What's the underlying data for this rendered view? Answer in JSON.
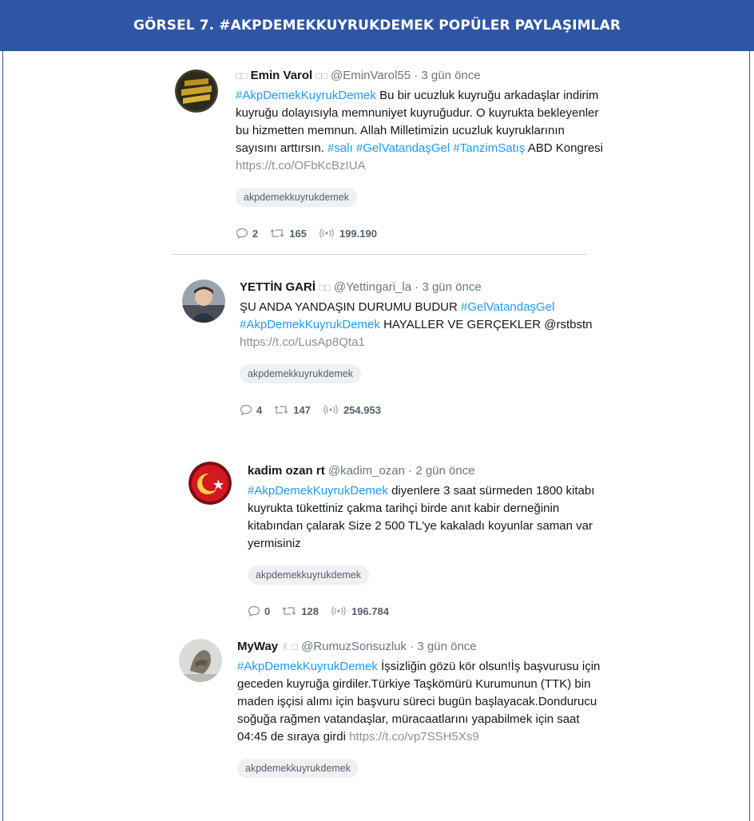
{
  "banner": {
    "title": "GÖRSEL 7. #AKPDEMEKKUYRUKDEMEK POPÜLER PAYLAŞIMLAR"
  },
  "tweets": [
    {
      "pre": "□□",
      "name": "Emin Varol",
      "post": "□□",
      "handle": "@EminVarol55",
      "dot": "·",
      "time": "3 gün önce",
      "avatar": "emin-varol-logo",
      "body": [
        {
          "t": "tag",
          "v": "#AkpDemekKuyrukDemek"
        },
        {
          "t": "text",
          "v": " Bu bir ucuzluk kuyruğu arkadaşlar indirim kuyruğu dolayısıyla memnuniyet kuyruğudur. O kuyrukta bekleyenler bu hizmetten memnun. Allah Milletimizin ucuzluk kuyruklarının sayısını arttırsın. "
        },
        {
          "t": "tag",
          "v": "#salı"
        },
        {
          "t": "text",
          "v": " "
        },
        {
          "t": "tag",
          "v": "#GelVatandaşGel"
        },
        {
          "t": "text",
          "v": " "
        },
        {
          "t": "tag",
          "v": "#TanzimSatış"
        },
        {
          "t": "text",
          "v": " ABD Kongresi "
        },
        {
          "t": "link",
          "v": "https://t.co/OFbKcBzIUA"
        }
      ],
      "chip": "akpdemekkuyrukdemek",
      "replies": "2",
      "retweets": "165",
      "reach": "199.190"
    },
    {
      "pre": "",
      "name": "YETTİN GARİ",
      "post": "□□",
      "handle": "@Yettingari_la",
      "dot": "·",
      "time": "3 gün önce",
      "avatar": "child-photo",
      "body": [
        {
          "t": "text",
          "v": "ŞU ANDA YANDAŞIN DURUMU BUDUR "
        },
        {
          "t": "tag",
          "v": "#GelVatandaşGel"
        },
        {
          "t": "text",
          "v": " "
        },
        {
          "t": "tag",
          "v": "#AkpDemekKuyrukDemek"
        },
        {
          "t": "text",
          "v": " HAYALLER VE GERÇEKLER @rstbstn "
        },
        {
          "t": "link",
          "v": "https://t.co/LusAp8Qta1"
        }
      ],
      "chip": "akpdemekkuyrukdemek",
      "replies": "4",
      "retweets": "147",
      "reach": "254.953"
    },
    {
      "pre": "",
      "name": "kadim ozan rt",
      "post": "",
      "handle": "@kadim_ozan",
      "dot": "·",
      "time": "2 gün önce",
      "avatar": "red-emblem",
      "body": [
        {
          "t": "tag",
          "v": "#AkpDemekKuyrukDemek"
        },
        {
          "t": "text",
          "v": " diyenlere 3 saat sürmeden 1800 kitabı kuyrukta tükettiniz çakma tarihçi birde anıt kabir derneğinin kitabından çalarak Size 2 500 TL'ye kakaladı koyunlar saman var yermisiniz"
        }
      ],
      "chip": "akpdemekkuyrukdemek",
      "replies": "0",
      "retweets": "128",
      "reach": "196.784"
    },
    {
      "pre": "",
      "name": "MyWay",
      "post": "✌ □",
      "handle": "@RumuzSonsuzluk",
      "dot": "·",
      "time": "3 gün önce",
      "avatar": "statue-photo",
      "body": [
        {
          "t": "tag",
          "v": "#AkpDemekKuyrukDemek"
        },
        {
          "t": "text",
          "v": " İşsizliğin gözü kör olsun!İş başvurusu için geceden kuyruğa girdiler.Türkiye Taşkömürü Kurumunun (TTK) bin maden işçisi alımı için başvuru süreci bugün başlayacak.Dondurucu soğuğa rağmen vatandaşlar, müracaatlarını yapabilmek için saat 04:45 de sıraya girdi "
        },
        {
          "t": "link",
          "v": "https://t.co/vp7SSH5Xs9"
        }
      ],
      "chip": "akpdemekkuyrukdemek"
    }
  ]
}
